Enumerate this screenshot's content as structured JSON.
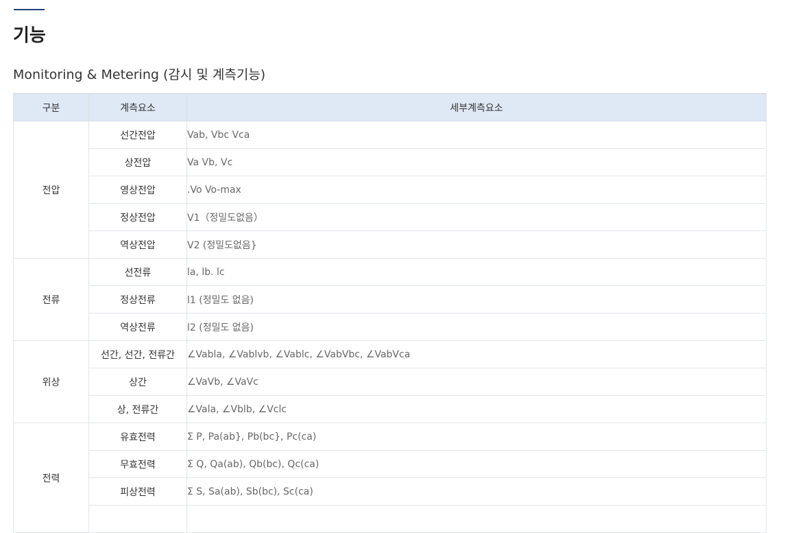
{
  "heading": {
    "page_title": "기능",
    "section_title": "Monitoring & Metering (감시 및 계측기능)"
  },
  "table": {
    "headers": [
      "구분",
      "계측요소",
      "세부계측요소"
    ],
    "groups": [
      {
        "label": "전압",
        "rows": [
          {
            "element": "선간전압",
            "detail": "Vab, Vbc Vca"
          },
          {
            "element": "상전압",
            "detail": "Va Vb, Vc"
          },
          {
            "element": "영상전압",
            "detail": ".Vo Vo-max"
          },
          {
            "element": "정상전압",
            "detail": "V1（정밀도없음）"
          },
          {
            "element": "역상전압",
            "detail": "V2 (정밀도없음}"
          }
        ]
      },
      {
        "label": "전류",
        "rows": [
          {
            "element": "선전류",
            "detail": "la, lb. lc"
          },
          {
            "element": "정상전류",
            "detail": "l1 (정밀도 없음)"
          },
          {
            "element": "역상전류",
            "detail": "l2 (정밀도 없음)"
          }
        ]
      },
      {
        "label": "위상",
        "rows": [
          {
            "element": "선간, 선간, 전류간",
            "detail": "∠Vabla, ∠Vablvb, ∠Vablc, ∠VabVbc, ∠VabVca"
          },
          {
            "element": "상간",
            "detail": "∠VaVb, ∠VaVc"
          },
          {
            "element": "상, 전류간",
            "detail": "∠Vala, ∠Vblb, ∠Vclc"
          }
        ]
      },
      {
        "label": "전력",
        "rows": [
          {
            "element": "유효전력",
            "detail": "Σ P, Pa(ab}, Pb(bc}, Pc(ca)"
          },
          {
            "element": "무효전력",
            "detail": "Σ Q, Qa(ab), Qb(bc), Qc(ca)"
          },
          {
            "element": "피상전력",
            "detail": "Σ S, Sa(ab), Sb(bc), Sc(ca)"
          }
        ]
      }
    ]
  }
}
